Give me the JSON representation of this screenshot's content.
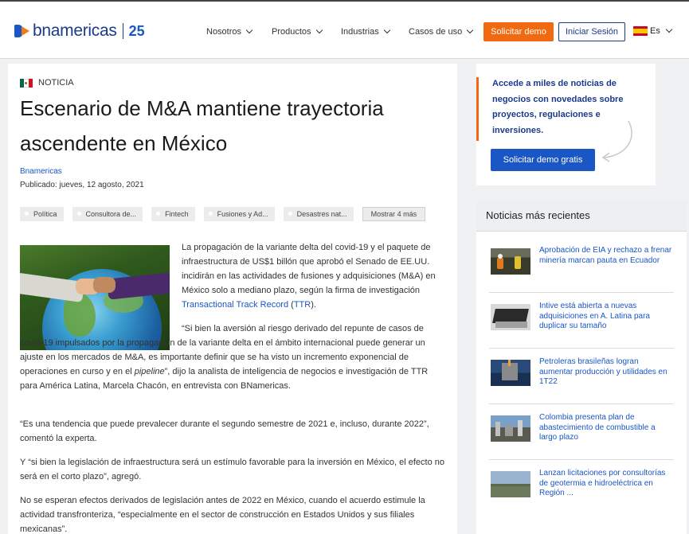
{
  "header": {
    "logo": {
      "name": "bnamericas",
      "anniversary": "25"
    },
    "nav": [
      {
        "label": "Nosotros"
      },
      {
        "label": "Productos"
      },
      {
        "label": "Industrias"
      },
      {
        "label": "Casos de uso"
      }
    ],
    "demo_button": "Solicitar demo",
    "login_button": "Iniciar Sesión",
    "language": "Es"
  },
  "article": {
    "kicker": "NOTICIA",
    "title": "Escenario de M&A mantiene trayectoria ascendente en México",
    "author": "Bnamericas",
    "published": "Publicado: jueves, 12 agosto, 2021",
    "tags": [
      "Política",
      "Consultora de...",
      "Fintech",
      "Fusiones y Ad...",
      "Desastres nat..."
    ],
    "tags_more": "Mostrar 4 más",
    "p1_a": "La propagación de la variante delta del covid-19 y el paquete de infraestructura de US$1 billón que aprobó el Senado de EE.UU. incidirán en las actividades de fusiones y adquisiciones (M&A) en México solo a mediano plazo, según la firma de investigación ",
    "p1_link1": "Transactional Track Record",
    "p1_b": " (",
    "p1_link2": "TTR",
    "p1_c": ").",
    "p2_a": "“Si bien la aversión al riesgo derivado del repunte de casos de covid-19 impulsados por la propagación de la variante delta en el ámbito internacional puede generar un ajuste en los mercados de M&A, es importante definir que se ha visto un incremento exponencial de operaciones en curso y en el ",
    "p2_italic": "pipeline",
    "p2_b": "”, dijo la analista de inteligencia de negocios e investigación de TTR para América Latina, Marcela Chacón, en entrevista con BNamericas.",
    "p3": "“Es una tendencia que puede prevalecer durante el segundo semestre de 2021 e, incluso, durante 2022”, comentó la experta.",
    "p4": "Y “si bien la legislación de infraestructura será un estímulo favorable para la inversión en México, el efecto no será en el corto plazo”, agregó.",
    "p5": "No se esperan efectos derivados de legislación antes de 2022 en México, cuando el acuerdo estimule la actividad transfronteriza, “especialmente en el sector de construcción en Estados Unidos y sus filiales mexicanas”."
  },
  "promo": {
    "text": "Accede a miles de noticias de negocios con novedades sobre proyectos, regulaciones e inversiones.",
    "button": "Solicitar demo gratis"
  },
  "news": {
    "heading": "Noticias más recientes",
    "items": [
      {
        "title": "Aprobación de EIA y rechazo a frenar minería marcan pauta en Ecuador"
      },
      {
        "title": "Intive está abierta a nuevas adquisiciones en A. Latina para duplicar su tamaño"
      },
      {
        "title": "Petroleras brasileñas logran aumentar producción y utilidades en 1T22"
      },
      {
        "title": "Colombia presenta plan de abastecimiento de combustible a largo plazo"
      },
      {
        "title": "Lanzan licitaciones por consultorías de geotermia e hidroeléctrica en Región ..."
      }
    ]
  },
  "colors": {
    "brand_blue": "#1a56c4",
    "brand_navy": "#1a3a8a",
    "accent_orange": "#f26a10"
  }
}
